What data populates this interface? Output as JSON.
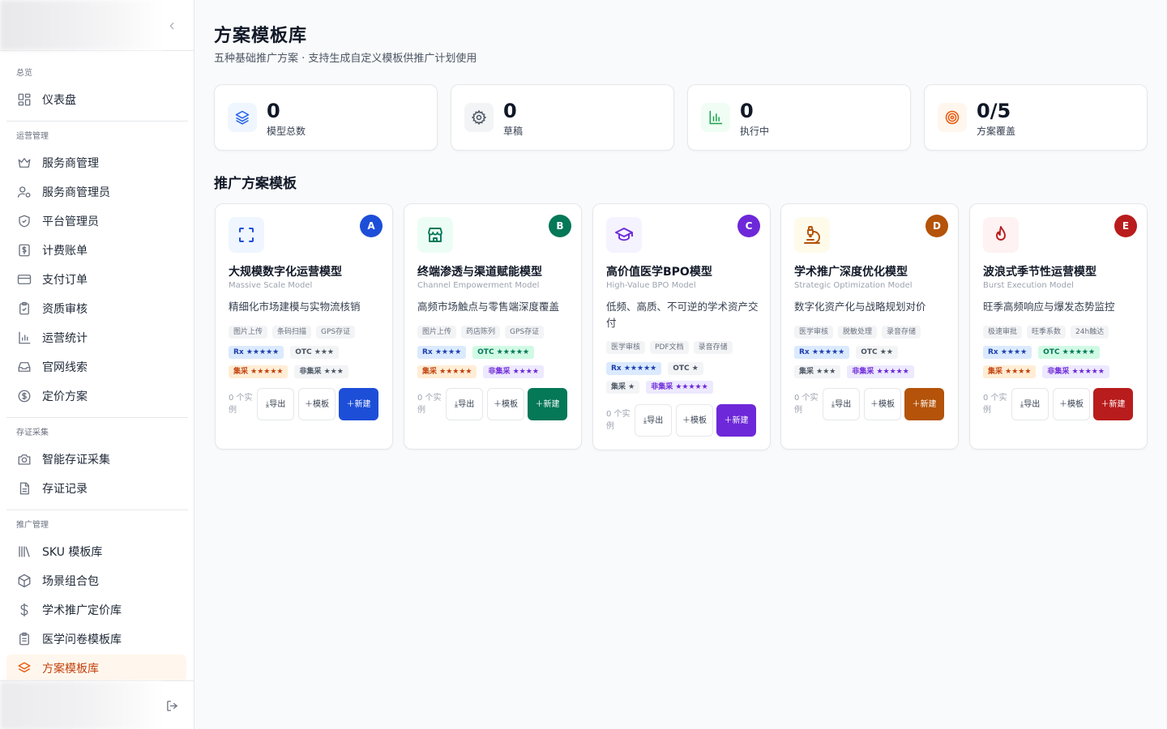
{
  "sidebar": {
    "sections": [
      {
        "title": "总览",
        "items": [
          {
            "label": "仪表盘",
            "icon": "dashboard-icon"
          }
        ]
      },
      {
        "title": "运营管理",
        "items": [
          {
            "label": "服务商管理",
            "icon": "crown-icon"
          },
          {
            "label": "服务商管理员",
            "icon": "user-gear-icon"
          },
          {
            "label": "平台管理员",
            "icon": "shield-check-icon"
          },
          {
            "label": "计费账单",
            "icon": "bill-dollar-icon"
          },
          {
            "label": "支付订单",
            "icon": "credit-card-icon"
          },
          {
            "label": "资质审核",
            "icon": "clipboard-check-icon"
          },
          {
            "label": "运营统计",
            "icon": "bar-chart-icon"
          },
          {
            "label": "官网线索",
            "icon": "inbox-icon"
          },
          {
            "label": "定价方案",
            "icon": "dollar-circle-icon"
          }
        ]
      },
      {
        "title": "存证采集",
        "items": [
          {
            "label": "智能存证采集",
            "icon": "camera-icon"
          },
          {
            "label": "存证记录",
            "icon": "document-icon"
          }
        ]
      },
      {
        "title": "推广管理",
        "items": [
          {
            "label": "SKU 模板库",
            "icon": "library-icon"
          },
          {
            "label": "场景组合包",
            "icon": "package-icon"
          },
          {
            "label": "学术推广定价库",
            "icon": "dollar-sign-icon"
          },
          {
            "label": "医学问卷模板库",
            "icon": "clipboard-list-icon"
          },
          {
            "label": "方案模板库",
            "icon": "layers-icon",
            "active": true
          }
        ]
      }
    ]
  },
  "header": {
    "title": "方案模板库",
    "subtitle": "五种基础推广方案 · 支持生成自定义模板供推广计划使用"
  },
  "stats": [
    {
      "value": "0",
      "label": "模型总数",
      "icon": "layers-icon",
      "color": "#2563eb",
      "bg": "#eff6ff"
    },
    {
      "value": "0",
      "label": "草稿",
      "icon": "gear-icon",
      "color": "#4b5563",
      "bg": "#f3f4f6"
    },
    {
      "value": "0",
      "label": "执行中",
      "icon": "bar-chart-icon",
      "color": "#16a34a",
      "bg": "#f0fdf4"
    },
    {
      "value": "0/5",
      "label": "方案覆盖",
      "icon": "target-icon",
      "color": "#ea580c",
      "bg": "#fff7ed"
    }
  ],
  "section_title": "推广方案模板",
  "templates": [
    {
      "badge": "A",
      "color": "#1d4ed8",
      "icon_bg": "#eff6ff",
      "icon": "scan-frame-icon",
      "name": "大规模数字化运营模型",
      "en": "Massive Scale Model",
      "desc": "精细化市场建模与实物流核销",
      "tags": [
        "图片上传",
        "条码扫描",
        "GPS存证"
      ],
      "ratings": [
        [
          {
            "label": "Rx ★★★★★",
            "style": "blue"
          },
          {
            "label": "OTC ★★★",
            "style": "gray"
          }
        ],
        [
          {
            "label": "集采 ★★★★★",
            "style": "orange"
          },
          {
            "label": "非集采 ★★★",
            "style": "gray"
          }
        ]
      ],
      "count": "0 个实例",
      "export": "导出",
      "template": "模板",
      "new": "新建"
    },
    {
      "badge": "B",
      "color": "#047857",
      "icon_bg": "#ecfdf5",
      "icon": "store-icon",
      "name": "终端渗透与渠道赋能模型",
      "en": "Channel Empowerment Model",
      "desc": "高频市场触点与零售端深度覆盖",
      "tags": [
        "图片上传",
        "药店陈列",
        "GPS存证"
      ],
      "ratings": [
        [
          {
            "label": "Rx ★★★★",
            "style": "blue"
          },
          {
            "label": "OTC ★★★★★",
            "style": "green"
          }
        ],
        [
          {
            "label": "集采 ★★★★★",
            "style": "orange"
          },
          {
            "label": "非集采 ★★★★",
            "style": "purple"
          }
        ]
      ],
      "count": "0 个实例",
      "export": "导出",
      "template": "模板",
      "new": "新建"
    },
    {
      "badge": "C",
      "color": "#6d28d9",
      "icon_bg": "#f5f3ff",
      "icon": "graduation-cap-icon",
      "name": "高价值医学BPO模型",
      "en": "High-Value BPO Model",
      "desc": "低频、高质、不可逆的学术资产交付",
      "tags": [
        "医学审核",
        "PDF文档",
        "录音存储"
      ],
      "ratings": [
        [
          {
            "label": "Rx ★★★★★",
            "style": "blue"
          },
          {
            "label": "OTC ★",
            "style": "gray"
          }
        ],
        [
          {
            "label": "集采 ★",
            "style": "gray"
          },
          {
            "label": "非集采 ★★★★★",
            "style": "purple"
          }
        ]
      ],
      "count": "0 个实例",
      "export": "导出",
      "template": "模板",
      "new": "新建"
    },
    {
      "badge": "D",
      "color": "#b45309",
      "icon_bg": "#fffbeb",
      "icon": "microscope-icon",
      "name": "学术推广深度优化模型",
      "en": "Strategic Optimization Model",
      "desc": "数字化资产化与战略规划对价",
      "tags": [
        "医学审核",
        "脱敏处理",
        "录音存储"
      ],
      "ratings": [
        [
          {
            "label": "Rx ★★★★★",
            "style": "blue"
          },
          {
            "label": "OTC ★★",
            "style": "gray"
          }
        ],
        [
          {
            "label": "集采 ★★★",
            "style": "gray"
          },
          {
            "label": "非集采 ★★★★★",
            "style": "purple"
          }
        ]
      ],
      "count": "0 个实例",
      "export": "导出",
      "template": "模板",
      "new": "新建"
    },
    {
      "badge": "E",
      "color": "#b91c1c",
      "icon_bg": "#fef2f2",
      "icon": "flame-icon",
      "name": "波浪式季节性运营模型",
      "en": "Burst Execution Model",
      "desc": "旺季高频响应与爆发态势监控",
      "tags": [
        "极速审批",
        "旺季系数",
        "24h触达"
      ],
      "ratings": [
        [
          {
            "label": "Rx ★★★★",
            "style": "blue"
          },
          {
            "label": "OTC ★★★★★",
            "style": "green"
          }
        ],
        [
          {
            "label": "集采 ★★★★",
            "style": "orange"
          },
          {
            "label": "非集采 ★★★★★",
            "style": "purple"
          }
        ]
      ],
      "count": "0 个实例",
      "export": "导出",
      "template": "模板",
      "new": "新建"
    }
  ]
}
